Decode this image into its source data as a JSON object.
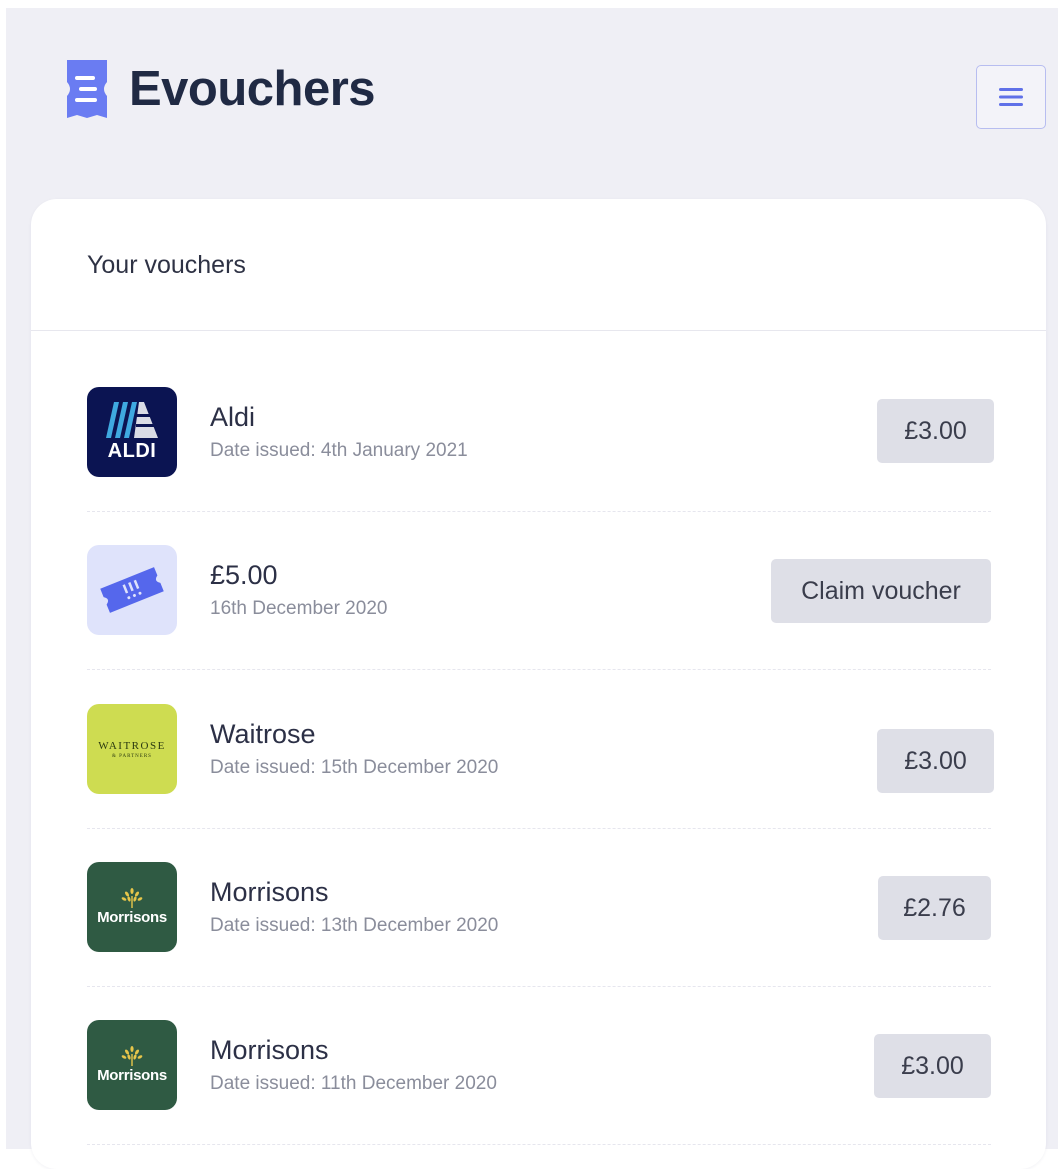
{
  "app": {
    "name": "Evouchers",
    "icons": {
      "brand": "ticket-icon",
      "menu": "hamburger-menu-icon"
    }
  },
  "card": {
    "title": "Your vouchers"
  },
  "logo_text": {
    "aldi": "ALDI",
    "waitrose": "WAITROSE",
    "waitrose_sub": "& PARTNERS",
    "morrisons": "Morrisons"
  },
  "vouchers": [
    {
      "title": "Aldi",
      "subtitle": "Date issued: 4th January 2021",
      "action": "£3.00",
      "logo": "aldi-logo"
    },
    {
      "title": "£5.00",
      "subtitle": "16th December 2020",
      "action": "Claim voucher",
      "logo": "ticket-icon"
    },
    {
      "title": "Waitrose",
      "subtitle": "Date issued: 15th December 2020",
      "action": "£3.00",
      "logo": "waitrose-logo"
    },
    {
      "title": "Morrisons",
      "subtitle": "Date issued: 13th December 2020",
      "action": "£2.76",
      "logo": "morrisons-logo"
    },
    {
      "title": "Morrisons",
      "subtitle": "Date issued: 11th December 2020",
      "action": "£3.00",
      "logo": "morrisons-logo"
    }
  ],
  "colors": {
    "brand_accent": "#6273f0",
    "brand_text": "#202a44",
    "background": "#efeff5",
    "button_bg": "#dedfe7",
    "aldi_navy": "#0b1452",
    "waitrose_green": "#cedc51",
    "morrisons_green": "#2f5a43"
  }
}
